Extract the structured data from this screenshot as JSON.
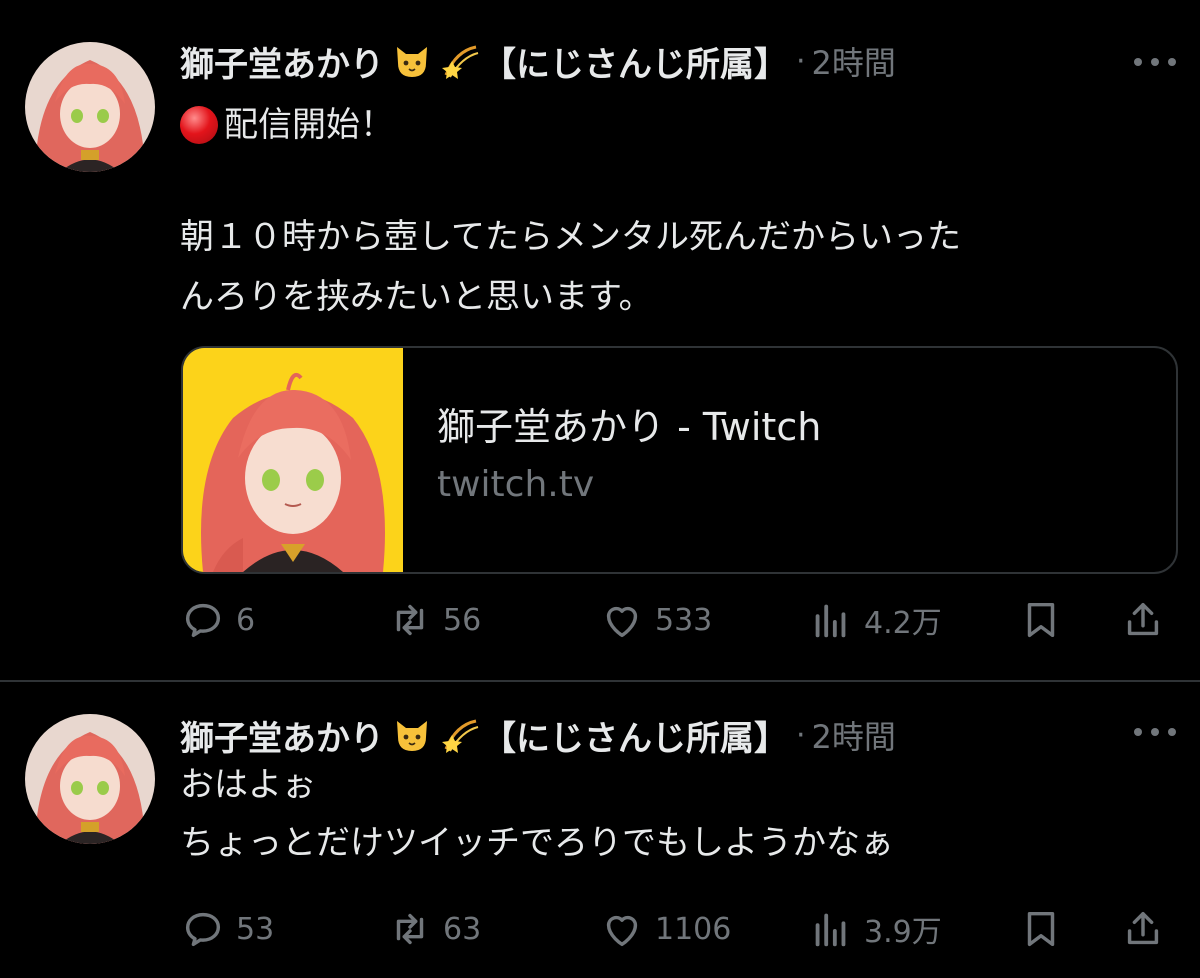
{
  "tweets": [
    {
      "author": "獅子堂あかり",
      "affiliation": "【にじさんじ所属】",
      "separator": "·",
      "time": "2時間",
      "lines": [
        "配信開始！",
        "朝１０時から壺してたらメンタル死んだからいった",
        "んろりを挟みたいと思います。"
      ],
      "card": {
        "title": "獅子堂あかり - Twitch",
        "domain": "twitch.tv"
      },
      "stats": {
        "replies": "6",
        "retweets": "56",
        "likes": "533",
        "views": "4.2万"
      }
    },
    {
      "author": "獅子堂あかり",
      "affiliation": "【にじさんじ所属】",
      "separator": "·",
      "time": "2時間",
      "lines": [
        "おはよぉ",
        "ちょっとだけツイッチでろりでもしようかなぁ"
      ],
      "stats": {
        "replies": "53",
        "retweets": "63",
        "likes": "1106",
        "views": "3.9万"
      }
    }
  ],
  "icons": {
    "name_emojis": [
      "cat-face-icon",
      "dizzy-star-icon"
    ],
    "live_marker": "red-circle-icon",
    "actions": [
      "reply-icon",
      "retweet-icon",
      "like-icon",
      "views-icon",
      "bookmark-icon",
      "share-icon"
    ]
  },
  "colors": {
    "background": "#000000",
    "text": "#e7e9ea",
    "muted": "#71767b",
    "card_bg": "#fcd31a",
    "divider": "#2f3336"
  }
}
